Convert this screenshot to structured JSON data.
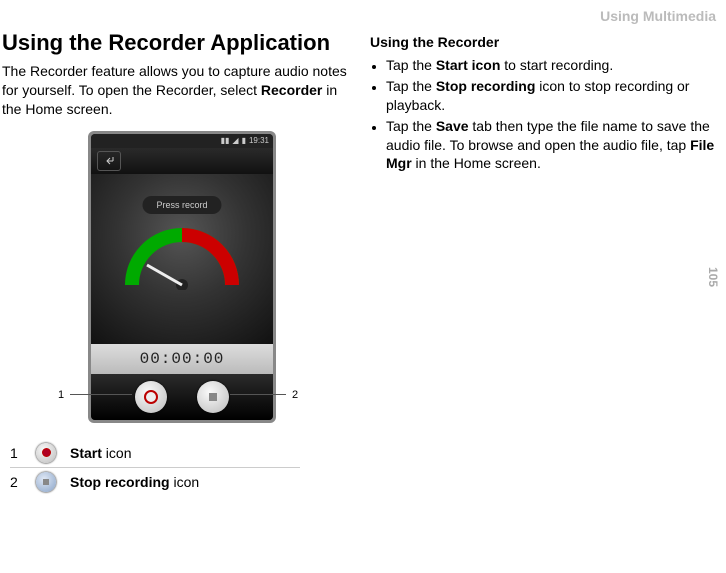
{
  "header": {
    "section": "Using Multimedia"
  },
  "page": {
    "number": "105"
  },
  "left": {
    "heading": "Using the Recorder Application",
    "intro_a": "The Recorder feature allows you to capture audio notes for yourself. To open the Recorder, select ",
    "intro_b": "Recorder",
    "intro_c": " in the Home screen.",
    "press_record": "Press record",
    "time": "00:00:00",
    "status_time": "19:31",
    "callout1": "1",
    "callout2": "2",
    "legend": {
      "row1_num": "1",
      "row1_bold": "Start",
      "row1_rest": " icon",
      "row2_num": "2",
      "row2_bold": "Stop recording",
      "row2_rest": " icon"
    }
  },
  "right": {
    "heading": "Using the Recorder",
    "b1_a": "Tap the ",
    "b1_b": "Start icon",
    "b1_c": " to start recording.",
    "b2_a": "Tap the ",
    "b2_b": "Stop recording",
    "b2_c": " icon to stop recording or playback.",
    "b3_a": "Tap the ",
    "b3_b": "Save",
    "b3_c": " tab then type the file name to save the audio file. To browse and open the audio file, tap ",
    "b3_d": "File Mgr",
    "b3_e": " in the Home screen."
  }
}
